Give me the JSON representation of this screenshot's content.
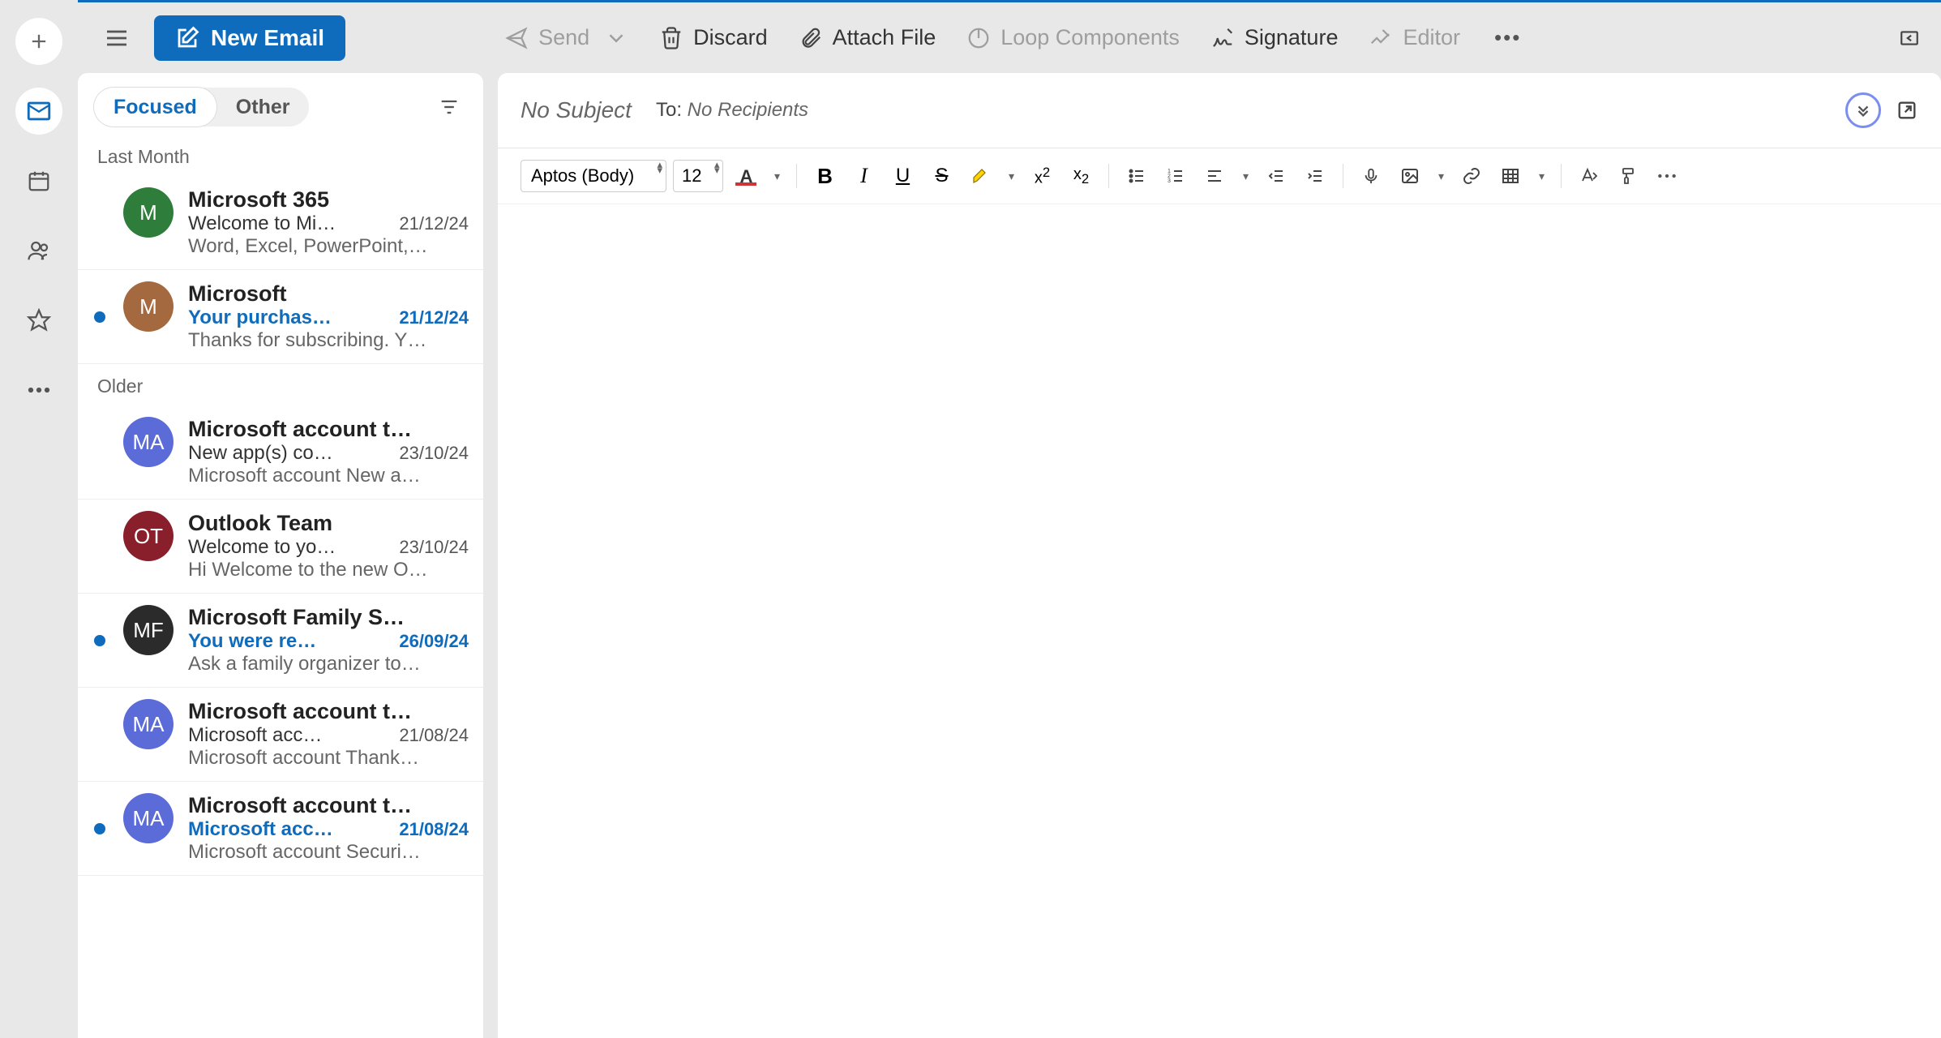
{
  "toolbar": {
    "new_email": "New Email",
    "send": "Send",
    "discard": "Discard",
    "attach_file": "Attach File",
    "loop_components": "Loop Components",
    "signature": "Signature",
    "editor": "Editor"
  },
  "tabs": {
    "focused": "Focused",
    "other": "Other"
  },
  "sections": {
    "last_month": "Last Month",
    "older": "Older"
  },
  "emails": [
    {
      "sender": "Microsoft 365",
      "subject": "Welcome to Mi…",
      "date": "21/12/24",
      "preview": "Word, Excel, PowerPoint,…",
      "initials": "M",
      "color": "#2f7d3b",
      "unread": false
    },
    {
      "sender": "Microsoft",
      "subject": "Your purchas…",
      "date": "21/12/24",
      "preview": "Thanks for subscribing. Y…",
      "initials": "M",
      "color": "#a5693f",
      "unread": true
    },
    {
      "sender": "Microsoft account t…",
      "subject": "New app(s) co…",
      "date": "23/10/24",
      "preview": "Microsoft account New a…",
      "initials": "MA",
      "color": "#5b6bd8",
      "unread": false
    },
    {
      "sender": "Outlook Team",
      "subject": "Welcome to yo…",
      "date": "23/10/24",
      "preview": "Hi Welcome to the new O…",
      "initials": "OT",
      "color": "#8a1f2c",
      "unread": false
    },
    {
      "sender": "Microsoft Family S…",
      "subject": "You were re…",
      "date": "26/09/24",
      "preview": "Ask a family organizer to…",
      "initials": "MF",
      "color": "#2b2b2b",
      "unread": true
    },
    {
      "sender": "Microsoft account t…",
      "subject": "Microsoft acc…",
      "date": "21/08/24",
      "preview": "Microsoft account Thank…",
      "initials": "MA",
      "color": "#5b6bd8",
      "unread": false
    },
    {
      "sender": "Microsoft account t…",
      "subject": "Microsoft acc…",
      "date": "21/08/24",
      "preview": "Microsoft account Securi…",
      "initials": "MA",
      "color": "#5b6bd8",
      "unread": true
    }
  ],
  "compose": {
    "subject": "No Subject",
    "to_label": "To:",
    "to_value": "No Recipients",
    "font": "Aptos (Body)",
    "size": "12"
  }
}
